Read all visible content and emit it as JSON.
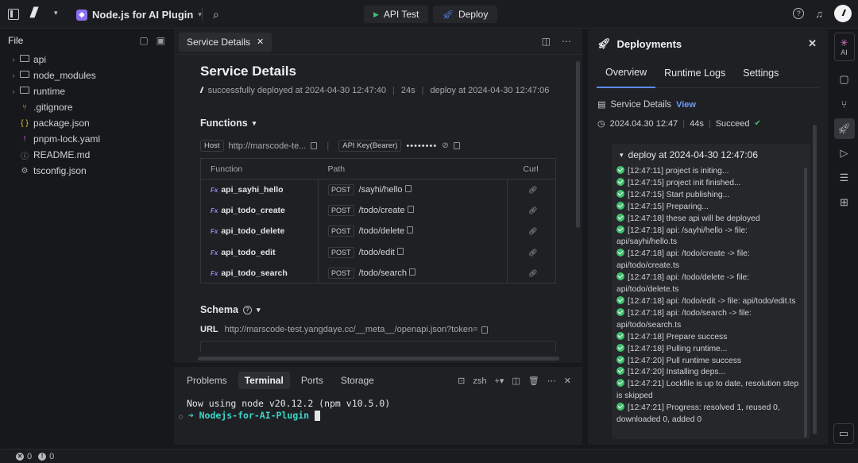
{
  "topbar": {
    "project_name": "Node.js for AI Plugin",
    "api_test_label": "API Test",
    "deploy_label": "Deploy"
  },
  "sidebar": {
    "title": "File",
    "items": [
      {
        "label": "api",
        "type": "folder"
      },
      {
        "label": "node_modules",
        "type": "folder"
      },
      {
        "label": "runtime",
        "type": "folder"
      },
      {
        "label": ".gitignore",
        "type": "git"
      },
      {
        "label": "package.json",
        "type": "json"
      },
      {
        "label": "pnpm-lock.yaml",
        "type": "yaml"
      },
      {
        "label": "README.md",
        "type": "info"
      },
      {
        "label": "tsconfig.json",
        "type": "config"
      }
    ]
  },
  "editor": {
    "tab_label": "Service Details",
    "title": "Service Details",
    "status": "successfully deployed at 2024-04-30 12:47:40",
    "duration": "24s",
    "deploy_at": "deploy at 2024-04-30 12:47:06",
    "functions_heading": "Functions",
    "host_label": "Host",
    "host_value": "http://marscode-te...",
    "api_key_label": "API Key(Bearer)",
    "api_key_value": "••••••••",
    "table_headers": [
      "Function",
      "Path",
      "Curl"
    ],
    "functions": [
      {
        "name": "api_sayhi_hello",
        "method": "POST",
        "path": "/sayhi/hello"
      },
      {
        "name": "api_todo_create",
        "method": "POST",
        "path": "/todo/create"
      },
      {
        "name": "api_todo_delete",
        "method": "POST",
        "path": "/todo/delete"
      },
      {
        "name": "api_todo_edit",
        "method": "POST",
        "path": "/todo/edit"
      },
      {
        "name": "api_todo_search",
        "method": "POST",
        "path": "/todo/search"
      }
    ],
    "schema_heading": "Schema",
    "url_label": "URL",
    "url_value": "http://marscode-test.yangdaye.cc/__meta__/openapi.json?token="
  },
  "terminal": {
    "tabs": [
      "Problems",
      "Terminal",
      "Ports",
      "Storage"
    ],
    "shell": "zsh",
    "line1": "Now using node v20.12.2 (npm v10.5.0)",
    "prompt": "➜  Nodejs-for-AI-Plugin"
  },
  "deployments": {
    "title": "Deployments",
    "tabs": [
      "Overview",
      "Runtime Logs",
      "Settings"
    ],
    "service_details_label": "Service Details",
    "view_label": "View",
    "deploy_time": "2024.04.30 12:47",
    "deploy_duration": "44s",
    "deploy_status": "Succeed",
    "log_title": "deploy at 2024-04-30 12:47:06",
    "logs": [
      "[12:47:11] project is initing...",
      "[12:47:15] project init finished...",
      "[12:47:15] Start publishing...",
      "[12:47:15] Preparing...",
      "[12:47:18] these api will be deployed",
      "[12:47:18]  api: /sayhi/hello -> file: api/sayhi/hello.ts",
      "[12:47:18]  api: /todo/create -> file: api/todo/create.ts",
      "[12:47:18]  api: /todo/delete -> file: api/todo/delete.ts",
      "[12:47:18]  api: /todo/edit -> file: api/todo/edit.ts",
      "[12:47:18]  api: /todo/search -> file: api/todo/search.ts",
      "[12:47:18] Prepare success",
      "[12:47:18] Pulling runtime...",
      "[12:47:20] Pull runtime success",
      "[12:47:20] Installing deps...",
      "[12:47:21] Lockfile is up to date, resolution step is skipped",
      "[12:47:21] Progress: resolved 1, reused 0, downloaded 0, added 0"
    ]
  },
  "rightbar": {
    "ai_label": "AI"
  },
  "statusbar": {
    "errors": "0",
    "warnings": "0"
  }
}
